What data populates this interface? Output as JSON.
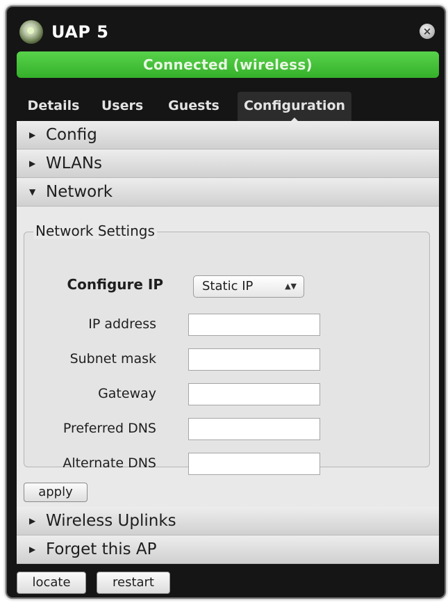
{
  "window": {
    "title": "UAP 5",
    "close_glyph": "×",
    "app_icon": "uap-device-icon"
  },
  "status": {
    "text": "Connected (wireless)",
    "color": "#3cbf30"
  },
  "tabs": [
    {
      "label": "Details",
      "active": false
    },
    {
      "label": "Users",
      "active": false
    },
    {
      "label": "Guests",
      "active": false
    },
    {
      "label": "Configuration",
      "active": true
    }
  ],
  "sections": {
    "config": {
      "label": "Config",
      "expanded": false
    },
    "wlans": {
      "label": "WLANs",
      "expanded": false
    },
    "network": {
      "label": "Network",
      "expanded": true
    },
    "wireless_uplinks": {
      "label": "Wireless Uplinks",
      "expanded": false
    },
    "forget_ap": {
      "label": "Forget this AP",
      "expanded": false
    }
  },
  "icons": {
    "collapsed": "▶",
    "expanded": "▼",
    "select_arrows": "▲▼"
  },
  "network_settings": {
    "legend": "Network Settings",
    "configure_ip_label": "Configure IP",
    "configure_ip_value": "Static IP",
    "ip_address_label": "IP address",
    "ip_address_value": "",
    "subnet_mask_label": "Subnet mask",
    "subnet_mask_value": "",
    "gateway_label": "Gateway",
    "gateway_value": "",
    "preferred_dns_label": "Preferred DNS",
    "preferred_dns_value": "",
    "alternate_dns_label": "Alternate DNS",
    "alternate_dns_value": "",
    "apply_label": "apply"
  },
  "footer": {
    "locate_label": "locate",
    "restart_label": "restart"
  }
}
